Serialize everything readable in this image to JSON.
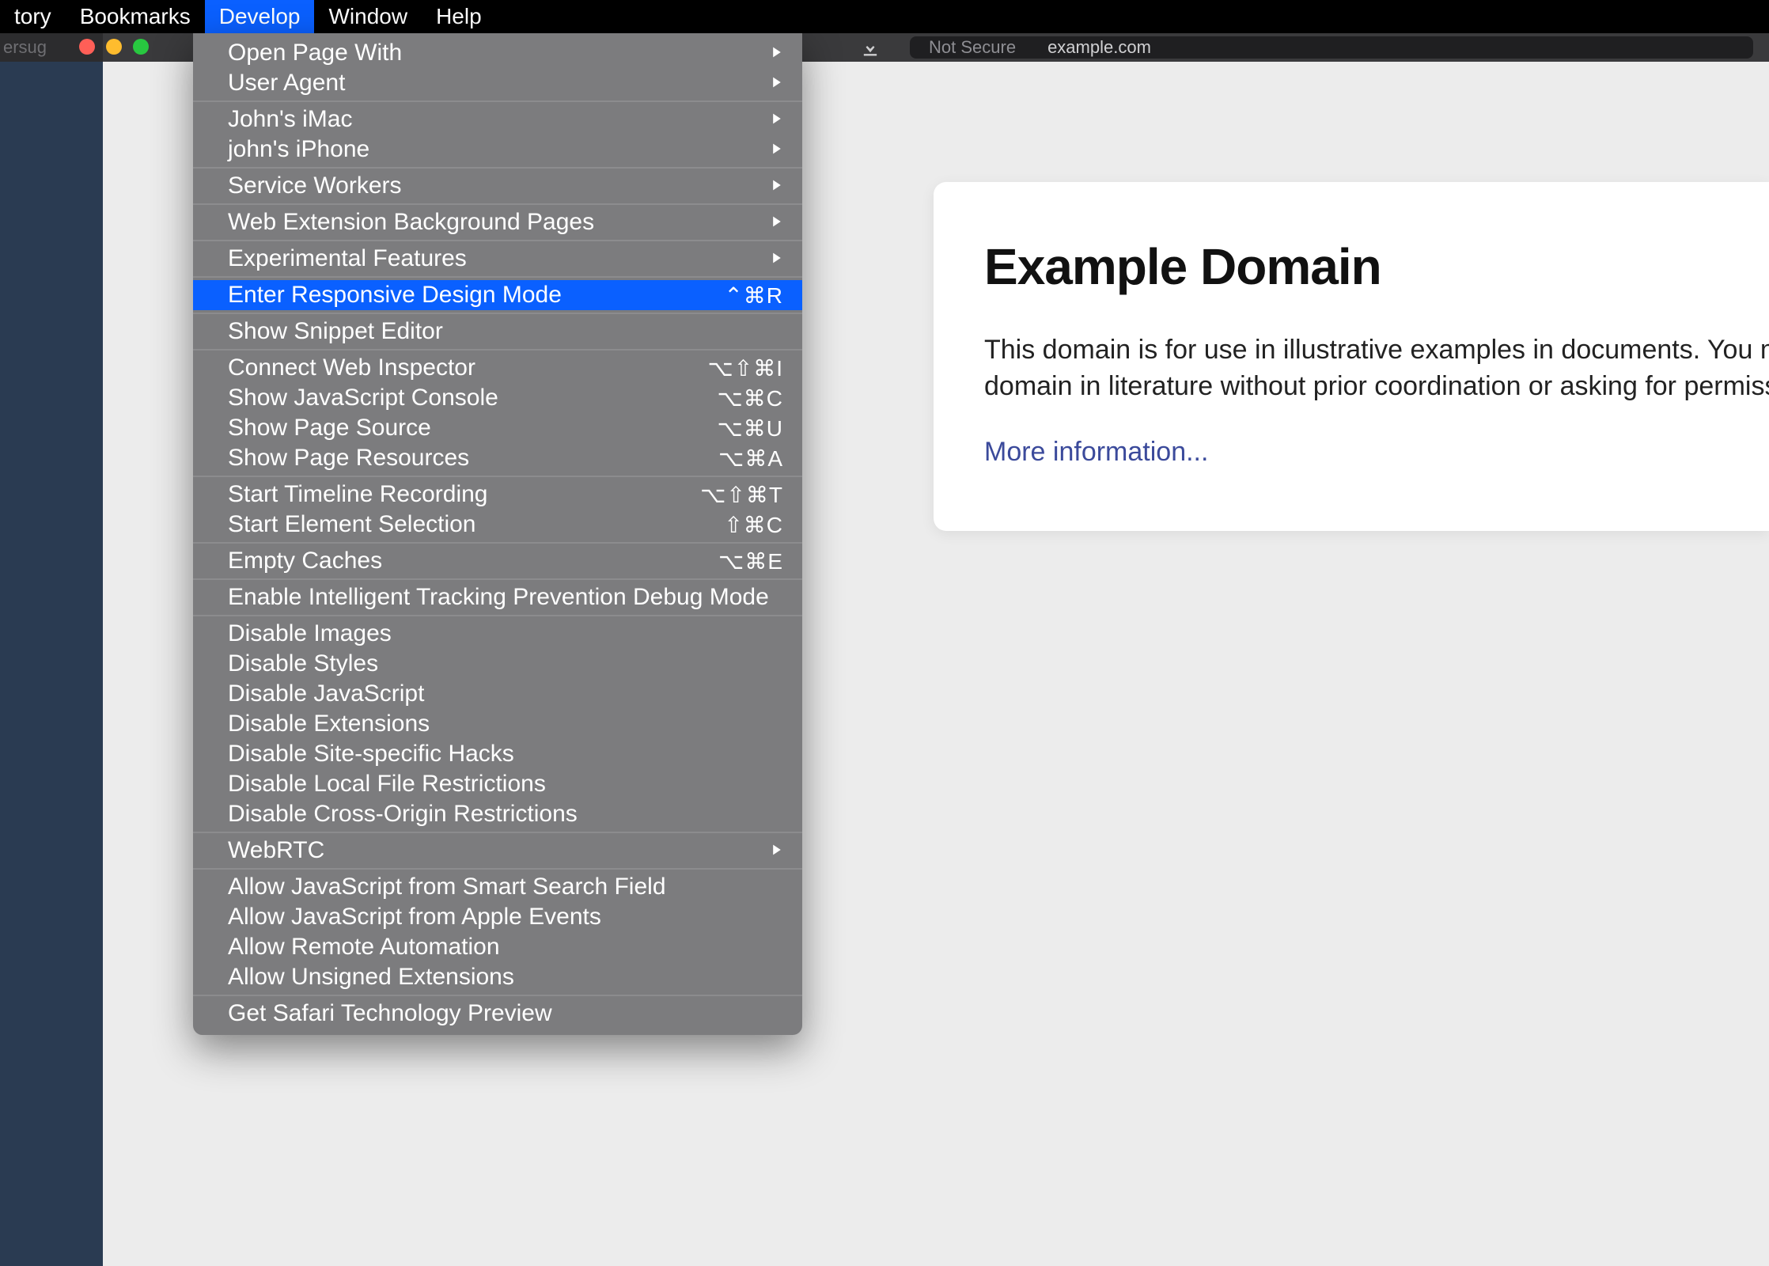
{
  "menubar": {
    "items": [
      {
        "label": "tory"
      },
      {
        "label": "Bookmarks"
      },
      {
        "label": "Develop"
      },
      {
        "label": "Window"
      },
      {
        "label": "Help"
      }
    ],
    "active_index": 2
  },
  "browser": {
    "tab_stub": "ersug",
    "address_secure": "Not Secure",
    "address_url": "example.com"
  },
  "page": {
    "title": "Example Domain",
    "body_line1": "This domain is for use in illustrative examples in documents. You may",
    "body_line2": "domain in literature without prior coordination or asking for permissio",
    "link": "More information..."
  },
  "dropdown": {
    "groups": [
      [
        {
          "label": "Open Page With",
          "submenu": true
        },
        {
          "label": "User Agent",
          "submenu": true
        }
      ],
      [
        {
          "label": "John's iMac",
          "submenu": true
        },
        {
          "label": "john's iPhone",
          "submenu": true
        }
      ],
      [
        {
          "label": "Service Workers",
          "submenu": true
        }
      ],
      [
        {
          "label": "Web Extension Background Pages",
          "submenu": true
        }
      ],
      [
        {
          "label": "Experimental Features",
          "submenu": true
        }
      ],
      [
        {
          "label": "Enter Responsive Design Mode",
          "shortcut": "⌃⌘R",
          "highlight": true
        }
      ],
      [
        {
          "label": "Show Snippet Editor"
        }
      ],
      [
        {
          "label": "Connect Web Inspector",
          "shortcut": "⌥⇧⌘I"
        },
        {
          "label": "Show JavaScript Console",
          "shortcut": "⌥⌘C"
        },
        {
          "label": "Show Page Source",
          "shortcut": "⌥⌘U"
        },
        {
          "label": "Show Page Resources",
          "shortcut": "⌥⌘A"
        }
      ],
      [
        {
          "label": "Start Timeline Recording",
          "shortcut": "⌥⇧⌘T"
        },
        {
          "label": "Start Element Selection",
          "shortcut": "⇧⌘C"
        }
      ],
      [
        {
          "label": "Empty Caches",
          "shortcut": "⌥⌘E"
        }
      ],
      [
        {
          "label": "Enable Intelligent Tracking Prevention Debug Mode"
        }
      ],
      [
        {
          "label": "Disable Images"
        },
        {
          "label": "Disable Styles"
        },
        {
          "label": "Disable JavaScript"
        },
        {
          "label": "Disable Extensions"
        },
        {
          "label": "Disable Site-specific Hacks"
        },
        {
          "label": "Disable Local File Restrictions"
        },
        {
          "label": "Disable Cross-Origin Restrictions"
        }
      ],
      [
        {
          "label": "WebRTC",
          "submenu": true
        }
      ],
      [
        {
          "label": "Allow JavaScript from Smart Search Field"
        },
        {
          "label": "Allow JavaScript from Apple Events"
        },
        {
          "label": "Allow Remote Automation"
        },
        {
          "label": "Allow Unsigned Extensions"
        }
      ],
      [
        {
          "label": "Get Safari Technology Preview"
        }
      ]
    ]
  }
}
